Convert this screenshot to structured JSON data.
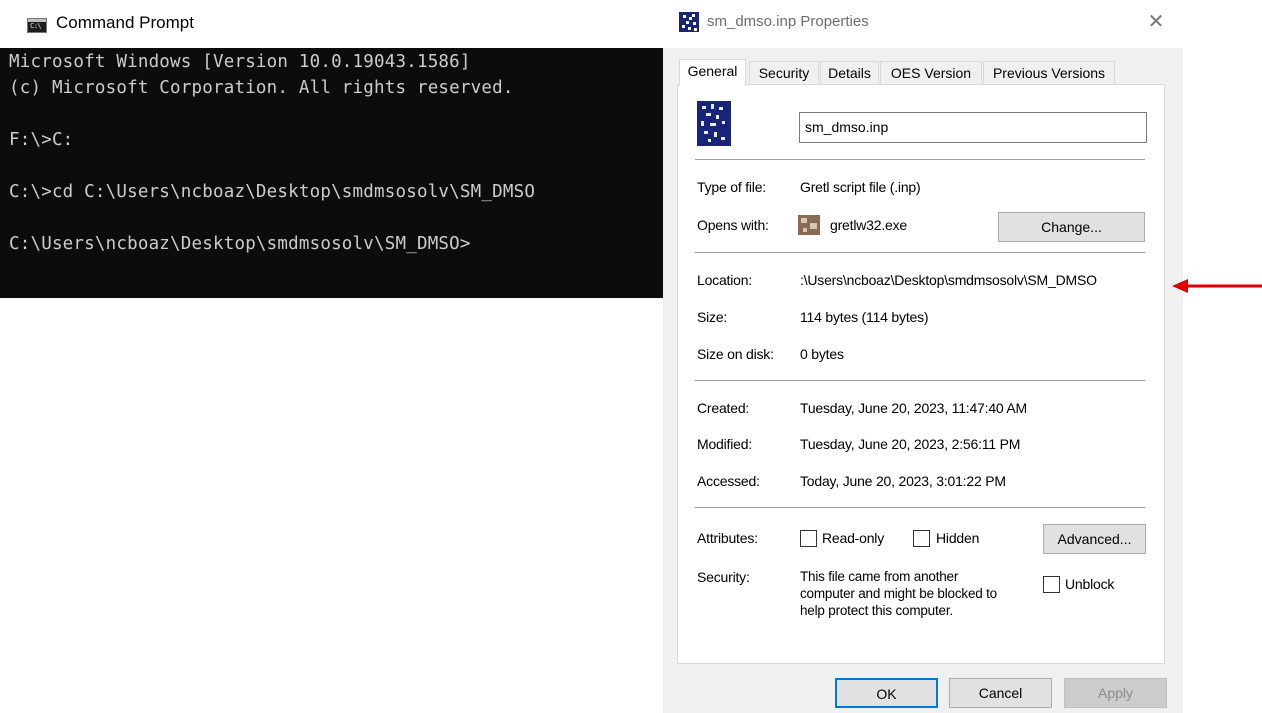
{
  "cmd": {
    "title": "Command Prompt",
    "icon_text": "C:\\",
    "lines": [
      "Microsoft Windows [Version 10.0.19043.1586]",
      "(c) Microsoft Corporation. All rights reserved.",
      "F:\\>C:",
      "C:\\>cd C:\\Users\\ncboaz\\Desktop\\smdmsosolv\\SM_DMSO",
      "C:\\Users\\ncboaz\\Desktop\\smdmsosolv\\SM_DMSO>"
    ]
  },
  "dialog": {
    "title": "sm_dmso.inp Properties",
    "close_glyph": "✕",
    "tabs": [
      "General",
      "Security",
      "Details",
      "OES Version",
      "Previous Versions"
    ],
    "active_tab": "General",
    "file_name": "sm_dmso.inp",
    "type_label": "Type of file:",
    "type_value": "Gretl script file (.inp)",
    "opens_label": "Opens with:",
    "opens_value": "gretlw32.exe",
    "change_button": "Change...",
    "location_label": "Location:",
    "location_value": ":\\Users\\ncboaz\\Desktop\\smdmsosolv\\SM_DMSO",
    "size_label": "Size:",
    "size_value": "114 bytes (114 bytes)",
    "size_on_disk_label": "Size on disk:",
    "size_on_disk_value": "0 bytes",
    "created_label": "Created:",
    "created_value": "Tuesday, June 20, 2023, 11:47:40 AM",
    "modified_label": "Modified:",
    "modified_value": "Tuesday, June 20, 2023, 2:56:11 PM",
    "accessed_label": "Accessed:",
    "accessed_value": "Today, June 20, 2023, 3:01:22 PM",
    "attributes_label": "Attributes:",
    "readonly_label": "Read-only",
    "hidden_label": "Hidden",
    "advanced_button": "Advanced...",
    "security_label": "Security:",
    "security_text_1": "This file came from another",
    "security_text_2": "computer and might be blocked to",
    "security_text_3": "help protect this computer.",
    "unblock_label": "Unblock",
    "ok_button": "OK",
    "cancel_button": "Cancel",
    "apply_button": "Apply"
  },
  "colors": {
    "console_bg": "#0c0c0c",
    "console_text": "#cccccc",
    "dialog_bg": "#f0f0f0",
    "arrow": "#e00000"
  }
}
